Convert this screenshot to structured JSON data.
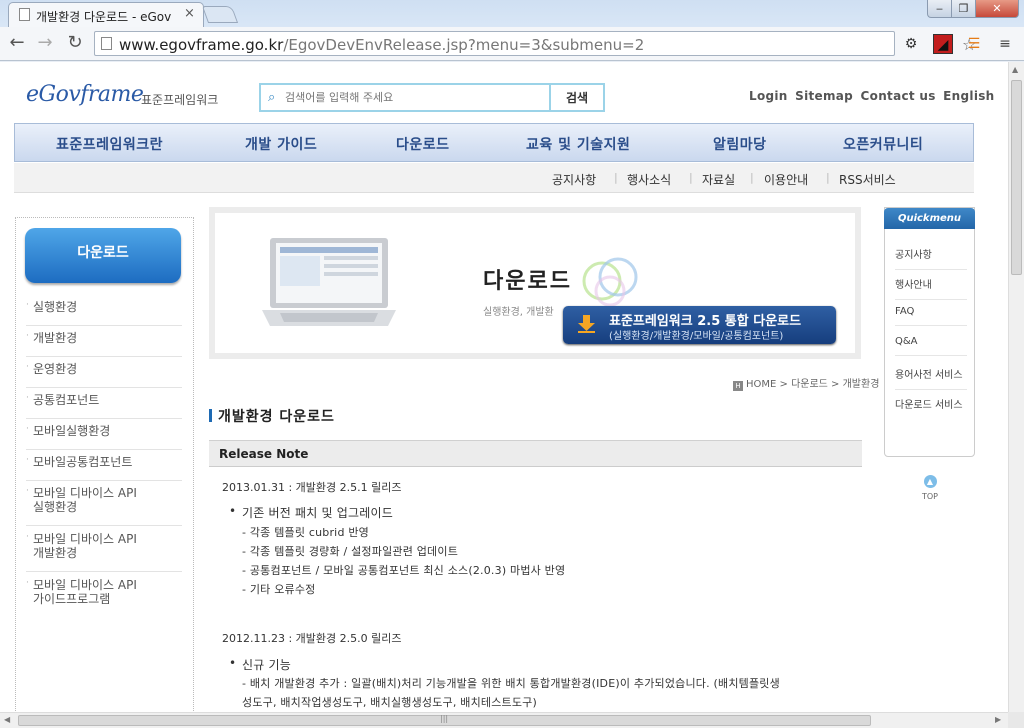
{
  "browser": {
    "tab_title": "개발환경 다운로드 - eGov",
    "tab_close": "×",
    "url_host": "www.egovframe.go.kr",
    "url_path": "/EgovDevEnvRelease.jsp?menu=3&submenu=2",
    "win_min": "‒",
    "win_max": "❐",
    "win_close": "✕"
  },
  "header": {
    "logo": "eGovframe",
    "logo_ko": "표준프레임워크",
    "search_placeholder": "검색어를 입력해 주세요",
    "search_button": "검색",
    "top_links": [
      "Login",
      "Sitemap",
      "Contact us",
      "English"
    ]
  },
  "gnb": [
    "표준프레임워크란",
    "개발 가이드",
    "다운로드",
    "교육 및 기술지원",
    "알림마당",
    "오픈커뮤니티"
  ],
  "subnav": [
    "공지사항",
    "행사소식",
    "자료실",
    "이용안내",
    "RSS서비스"
  ],
  "lnb": {
    "title": "다운로드",
    "items": [
      "실행환경",
      "개발환경",
      "운영환경",
      "공통컴포넌트",
      "모바일실행환경",
      "모바일공통컴포넌트",
      "모바일 디바이스 API\n실행환경",
      "모바일 디바이스 API\n개발환경",
      "모바일 디바이스 API\n가이드프로그램"
    ]
  },
  "banner": {
    "title": "다운로드",
    "subtitle": "실행환경, 개발환",
    "download_title": "표준프레임워크 2.5 통합 다운로드",
    "download_sub": "(실행환경/개발환경/모바일/공통컴포넌트)"
  },
  "breadcrumb": {
    "home": "H",
    "path": "HOME > 다운로드 > 개발환경"
  },
  "section_title": "개발환경 다운로드",
  "release_note": {
    "heading": "Release Note",
    "entries": [
      {
        "date": "2013.01.31 : 개발환경 2.5.1 릴리즈",
        "bullet": "기존 버전 패치 및 업그레이드",
        "lines": [
          "- 각종 템플릿 cubrid 반영",
          "- 각종 템플릿 경량화 / 설정파일관련 업데이트",
          "- 공통컴포넌트 / 모바일 공통컴포넌트 최신 소스(2.0.3) 마법사 반영",
          "- 기타 오류수정"
        ]
      },
      {
        "date": "2012.11.23 : 개발환경 2.5.0 릴리즈",
        "bullet": "신규 기능",
        "lines": [
          "- 배치 개발환경 추가 : 일괄(배치)처리 기능개발을 위한 배치 통합개발환경(IDE)이 추가되었습니다. (배치템플릿생",
          "성도구, 배치작업생성도구, 배치실행생성도구, 배치테스트도구)"
        ]
      }
    ]
  },
  "quickmenu": {
    "title": "Quickmenu",
    "items": [
      "공지사항",
      "행사안내",
      "FAQ",
      "Q&A",
      "용어사전 서비스",
      "다운로드 서비스"
    ],
    "top": "TOP"
  },
  "colors": {
    "accent": "#2a5aa6",
    "download_button": "#1f4a8c"
  }
}
